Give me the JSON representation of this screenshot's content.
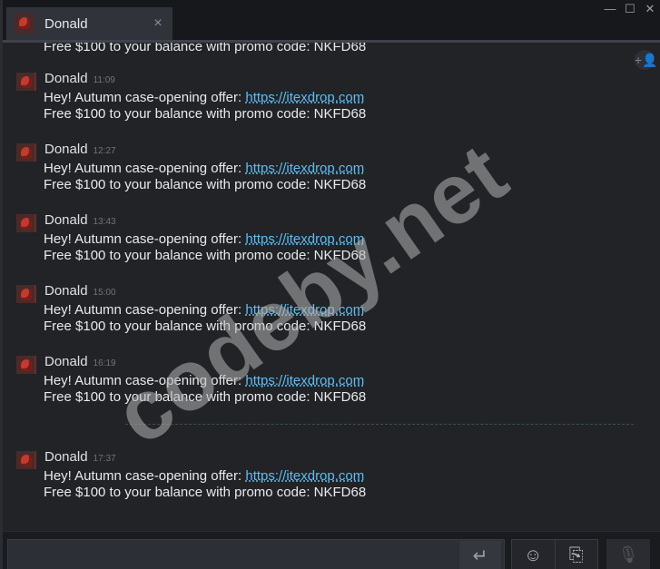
{
  "window": {
    "tab_title": "Donald",
    "tab_close": "×",
    "minimize": "—",
    "maximize": "☐",
    "close": "✕"
  },
  "chat": {
    "partial_top_line": "Free $100 to your balance with promo code: NKFD68",
    "add_friend_icon": "+👤",
    "messages": [
      {
        "sender": "Donald",
        "time": "11:09",
        "text": "Hey! Autumn case-opening offer: ",
        "link": "https://itexdrop.com",
        "text2": "Free $100 to your balance with promo code: NKFD68"
      },
      {
        "sender": "Donald",
        "time": "12:27",
        "text": "Hey! Autumn case-opening offer: ",
        "link": "https://itexdrop.com",
        "text2": "Free $100 to your balance with promo code: NKFD68"
      },
      {
        "sender": "Donald",
        "time": "13:43",
        "text": "Hey! Autumn case-opening offer: ",
        "link": "https://itexdrop.com",
        "text2": "Free $100 to your balance with promo code: NKFD68"
      },
      {
        "sender": "Donald",
        "time": "15:00",
        "text": "Hey! Autumn case-opening offer: ",
        "link": "https://itexdrop.com",
        "text2": "Free $100 to your balance with promo code: NKFD68"
      },
      {
        "sender": "Donald",
        "time": "16:19",
        "text": "Hey! Autumn case-opening offer: ",
        "link": "https://itexdrop.com",
        "text2": "Free $100 to your balance with promo code: NKFD68"
      },
      {
        "sender": "Donald",
        "time": "17:37",
        "text": "Hey! Autumn case-opening offer: ",
        "link": "https://itexdrop.com",
        "text2": "Free $100 to your balance with promo code: NKFD68"
      }
    ]
  },
  "watermark": "codeby.net",
  "composer": {
    "send_icon": "↵",
    "emoji_icon": "☺",
    "attach_icon": "⎘",
    "mic_icon": "🎙"
  },
  "colors": {
    "link": "#5fbdf3",
    "background": "#212327",
    "titlebar": "#16181c"
  }
}
